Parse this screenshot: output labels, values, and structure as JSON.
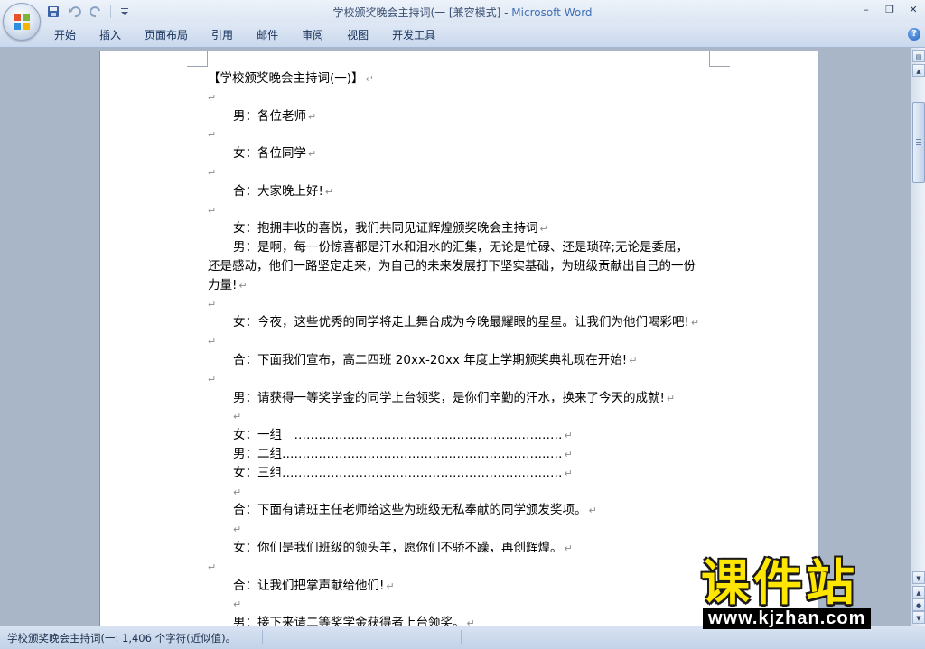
{
  "window": {
    "title_doc": "学校颁奖晚会主持词(一 [兼容模式]",
    "title_sep": " - ",
    "title_app": "Microsoft Word",
    "minimize": "–",
    "restore": "❐",
    "close": "✕"
  },
  "ribbon": {
    "tabs": [
      "开始",
      "插入",
      "页面布局",
      "引用",
      "邮件",
      "审阅",
      "视图",
      "开发工具"
    ]
  },
  "document": {
    "lines": [
      {
        "text": "【学校颁奖晚会主持词(一)】",
        "indent": false
      },
      {
        "text": "",
        "indent": false
      },
      {
        "text": "男：各位老师",
        "indent": true
      },
      {
        "text": "",
        "indent": false
      },
      {
        "text": "女：各位同学",
        "indent": true
      },
      {
        "text": "",
        "indent": false
      },
      {
        "text": "合：大家晚上好!",
        "indent": true
      },
      {
        "text": "",
        "indent": false
      },
      {
        "text": "女：抱拥丰收的喜悦，我们共同见证辉煌颁奖晚会主持词",
        "indent": true
      }
    ],
    "para": {
      "line1": "男：是啊，每一份惊喜都是汗水和泪水的汇集，无论是忙碌、还是琐碎;无论是委屈，",
      "line2": "还是感动，他们一路坚定走来，为自己的未来发展打下坚实基础，为班级贡献出自己的一份",
      "line3": "力量!"
    },
    "lines2": [
      {
        "text": "",
        "indent": false
      },
      {
        "text": "女：今夜，这些优秀的同学将走上舞台成为今晚最耀眼的星星。让我们为他们喝彩吧!",
        "indent": true
      },
      {
        "text": "",
        "indent": false
      },
      {
        "text": "合：下面我们宣布，高二四班 20xx-20xx 年度上学期颁奖典礼现在开始!",
        "indent": true
      },
      {
        "text": "",
        "indent": false
      },
      {
        "text": "男：请获得一等奖学金的同学上台领奖，是你们辛勤的汗水，换来了今天的成就!",
        "indent": true
      },
      {
        "text": "",
        "indent": true
      },
      {
        "text": "女：一组　…………………………………………………………",
        "indent": true
      },
      {
        "text": "男：二组……………………………………………………………",
        "indent": true
      },
      {
        "text": "女：三组……………………………………………………………",
        "indent": true
      },
      {
        "text": "",
        "indent": true
      },
      {
        "text": "合：下面有请班主任老师给这些为班级无私奉献的同学颁发奖项。",
        "indent": true
      },
      {
        "text": "",
        "indent": true
      },
      {
        "text": "女：你们是我们班级的领头羊，愿你们不骄不躁，再创辉煌。",
        "indent": true
      },
      {
        "text": "",
        "indent": false
      },
      {
        "text": "合：让我们把掌声献给他们!",
        "indent": true
      },
      {
        "text": "",
        "indent": true
      },
      {
        "text": "男：接下来请二等奖学金获得者上台领奖。",
        "indent": true
      }
    ],
    "paragraph_mark": "↵"
  },
  "statusbar": {
    "text": "学校颁奖晚会主持词(一: 1,406 个字符(近似值)。"
  },
  "watermark": {
    "title": "课件站",
    "url": "www.kjzhan.com"
  }
}
